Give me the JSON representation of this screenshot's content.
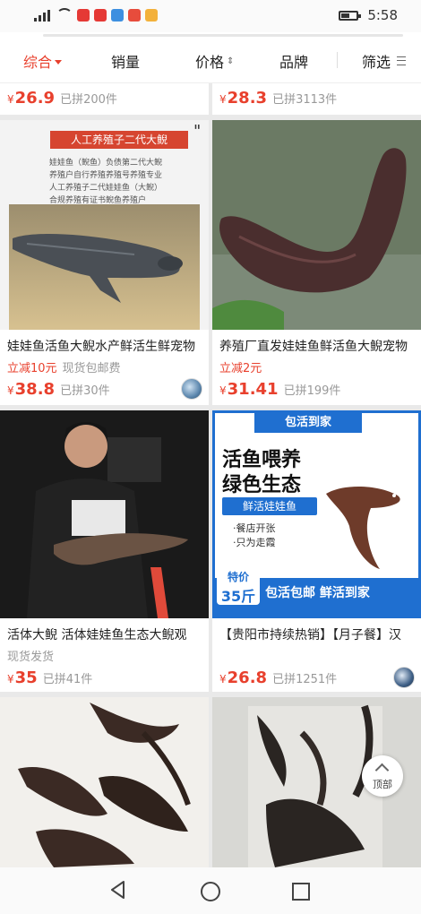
{
  "status_bar": {
    "time": "5:58"
  },
  "filters": [
    {
      "label": "综合",
      "active": true
    },
    {
      "label": "销量",
      "active": false
    },
    {
      "label": "价格",
      "active": false
    },
    {
      "label": "品牌",
      "active": false
    },
    {
      "label": "筛选",
      "active": false
    }
  ],
  "top_row": [
    {
      "currency": "¥",
      "price": "26.9",
      "sold": "已拼200件"
    },
    {
      "currency": "¥",
      "price": "28.3",
      "sold": "已拼3113件"
    }
  ],
  "products": [
    {
      "title": "娃娃鱼活鱼大鲵水产鲜活生鲜宠物",
      "promo": "立减10元",
      "promo_note": "现货包邮费",
      "currency": "¥",
      "price": "38.8",
      "sold": "已拼30件",
      "image_banner": "人工养殖子二代大鲵",
      "image_lines": [
        "娃娃鱼（鲵鱼）负债第二代大鲵",
        "养殖户自行养殖养殖号养殖专业",
        "人工养殖子二代娃娃鱼（大鲵）",
        "合规养殖有证书鲵鱼养殖户"
      ]
    },
    {
      "title": "养殖厂直发娃娃鱼鲜活鱼大鲵宠物",
      "promo": "立减2元",
      "currency": "¥",
      "price": "31.41",
      "sold": "已拼199件"
    },
    {
      "title": "活体大鲵 活体娃娃鱼生态大鲵观",
      "promo_note": "现货发货",
      "currency": "¥",
      "price": "35",
      "sold": "已拼41件"
    },
    {
      "title": "【贵阳市持续热销】【月子餐】汉",
      "currency": "¥",
      "price": "26.8",
      "sold": "已拼1251件",
      "ad": {
        "badge": "包活到家",
        "headline1": "活鱼喂养",
        "headline2": "绿色生态",
        "pill": "鲜活娃娃鱼",
        "bullet1": "·餐店开张",
        "bullet2": "·只为走霞",
        "price_label": "特价",
        "price_value": "35斤",
        "strip": "包活包邮 鲜活到家"
      }
    }
  ],
  "fab": {
    "label": "顶部"
  },
  "colors": {
    "accent": "#e8402d",
    "ad_blue": "#1f6fd0"
  },
  "icons": [
    "signal-icon",
    "wifi-icon",
    "battery-icon",
    "back-icon",
    "home-icon",
    "recent-apps-icon",
    "back-to-top-icon"
  ]
}
